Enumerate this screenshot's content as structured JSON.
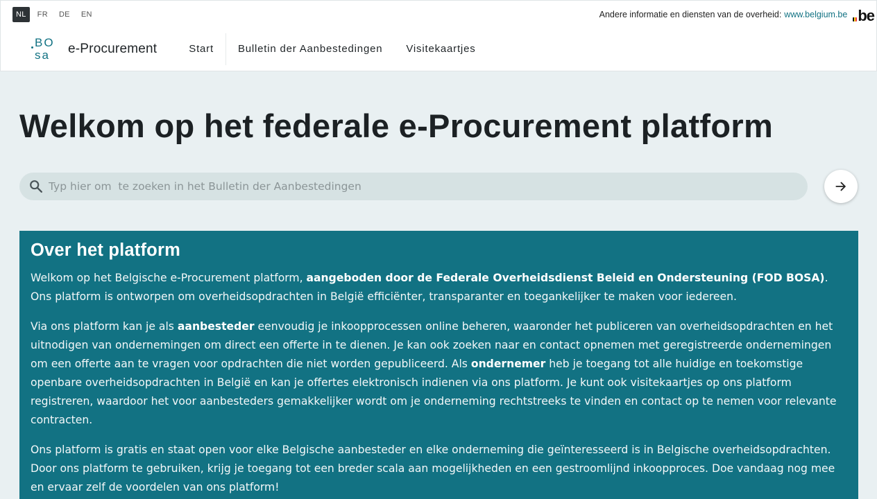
{
  "languages": [
    {
      "code": "NL",
      "active": true
    },
    {
      "code": "FR",
      "active": false
    },
    {
      "code": "DE",
      "active": false
    },
    {
      "code": "EN",
      "active": false
    }
  ],
  "gov_bar": {
    "text": "Andere informatie en diensten van de overheid:",
    "link": "www.belgium.be",
    "logo_text": "be"
  },
  "header": {
    "logo_top": "BO",
    "logo_bottom": "sa",
    "brand": "e-Procurement",
    "nav": [
      {
        "label": "Start"
      },
      {
        "label": "Bulletin der Aanbestedingen"
      },
      {
        "label": "Visitekaartjes"
      }
    ]
  },
  "hero": {
    "title": "Welkom op het federale e-Procurement platform",
    "search_placeholder": "Typ hier om  te zoeken in het Bulletin der Aanbestedingen"
  },
  "about": {
    "title": "Over het platform",
    "p1_a": "Welkom op het Belgische e-Procurement platform, ",
    "p1_b": "aangeboden door de Federale Overheidsdienst Beleid en Ondersteuning (FOD BOSA)",
    "p1_c": ". Ons platform is ontworpen om overheidsopdrachten in België efficiënter, transparanter en toegankelijker te maken voor iedereen.",
    "p2_a": "Via ons platform kan je als ",
    "p2_b": "aanbesteder",
    "p2_c": " eenvoudig je inkoopprocessen online beheren, waaronder het publiceren van overheidsopdrachten en het uitnodigen van ondernemingen om direct een offerte in te dienen. Je kan ook zoeken naar en contact opnemen met geregistreerde ondernemingen om een offerte aan te vragen voor opdrachten die niet worden gepubliceerd. Als ",
    "p2_d": "ondernemer",
    "p2_e": " heb je toegang tot alle huidige en toekomstige openbare overheidsopdrachten in België en kan je offertes elektronisch indienen via ons platform. Je kunt ook visitekaartjes op ons platform registreren, waardoor het voor aanbesteders gemakkelijker wordt om je onderneming rechtstreeks te vinden en contact op te nemen voor relevante contracten.",
    "p3": "Ons platform is gratis en staat open voor elke Belgische aanbesteder en elke onderneming die geïnteresseerd is in Belgische overheidsopdrachten. Door ons platform te gebruiken, krijg je toegang tot een breder scala aan mogelijkheden en een gestroomlijnd inkoopproces. Doe vandaag nog mee en ervaar zelf de voordelen van ons platform!"
  },
  "colors": {
    "accent": "#127283",
    "background": "#e9f0f2",
    "search_bg": "#d6e2e3"
  },
  "icons": {
    "search": "search-icon",
    "go": "arrow-right-icon"
  }
}
